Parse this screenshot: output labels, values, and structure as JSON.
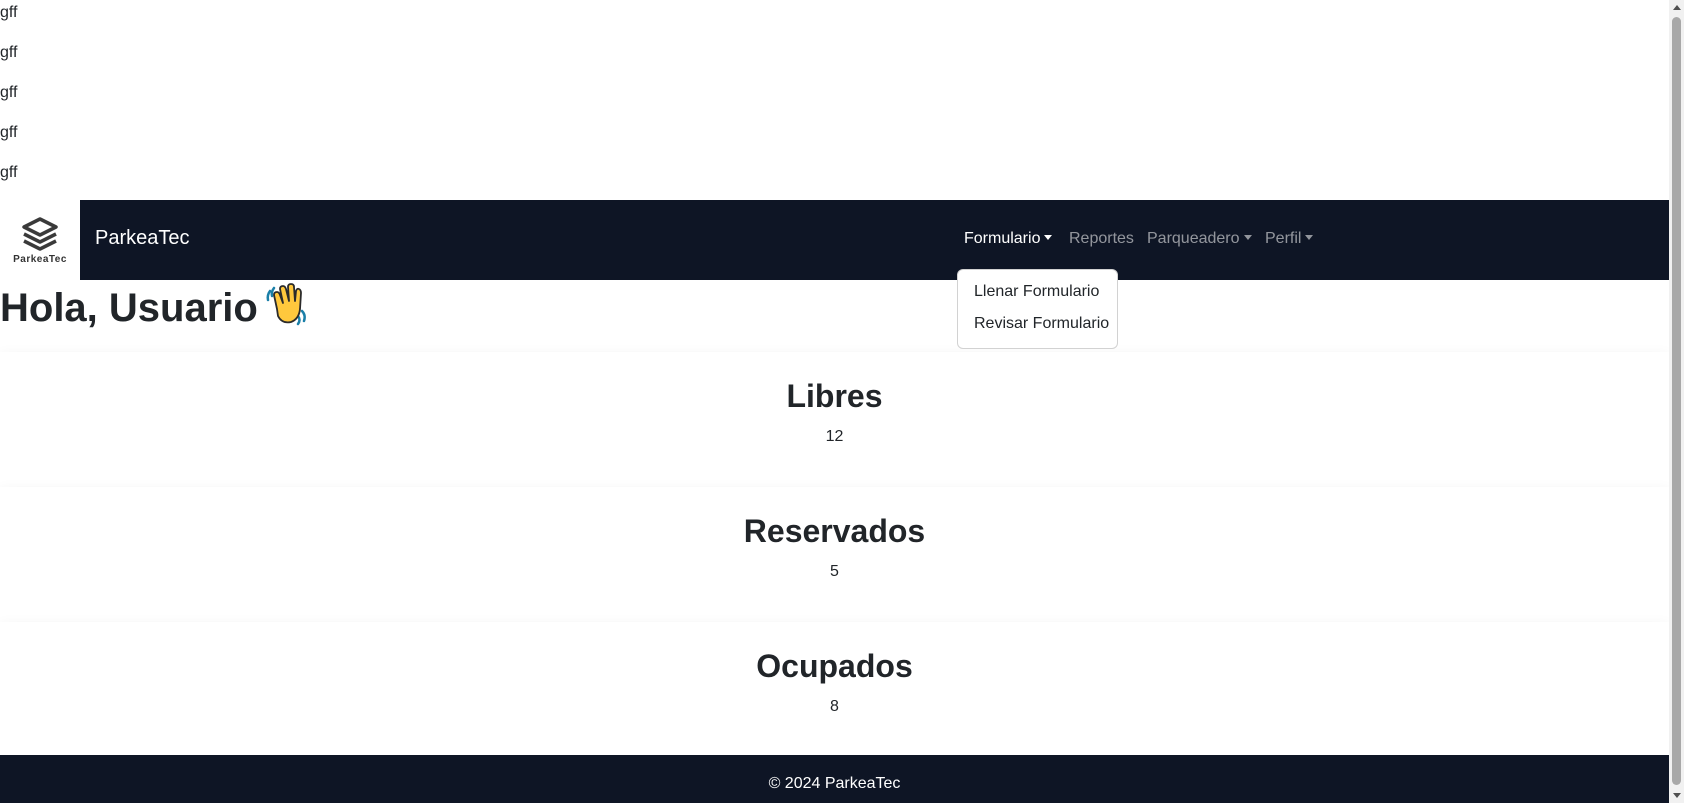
{
  "top_lines": [
    "gff",
    "gff",
    "gff",
    "gff",
    "gff"
  ],
  "navbar": {
    "logo_text": "ParkeaTec",
    "brand": "ParkeaTec",
    "items": [
      {
        "label": "Formulario",
        "has_caret": true,
        "active": true
      },
      {
        "label": "Reportes",
        "has_caret": false,
        "active": false
      },
      {
        "label": "Parqueadero",
        "has_caret": true,
        "active": false
      },
      {
        "label": "Perfil",
        "has_caret": true,
        "active": false
      }
    ]
  },
  "dropdown": {
    "items": [
      "Llenar Formulario",
      "Revisar Formulario"
    ]
  },
  "greeting": {
    "text": "Hola, Usuario",
    "emoji_icon": "waving-hand-icon"
  },
  "stats": [
    {
      "title": "Libres",
      "value": "12"
    },
    {
      "title": "Reservados",
      "value": "5"
    },
    {
      "title": "Ocupados",
      "value": "8"
    }
  ],
  "footer": {
    "text": "© 2024 ParkeaTec"
  },
  "colors": {
    "navbar_bg": "#0e1525",
    "nav_active": "#ffffff",
    "nav_inactive": "rgba(255,255,255,0.55)"
  }
}
